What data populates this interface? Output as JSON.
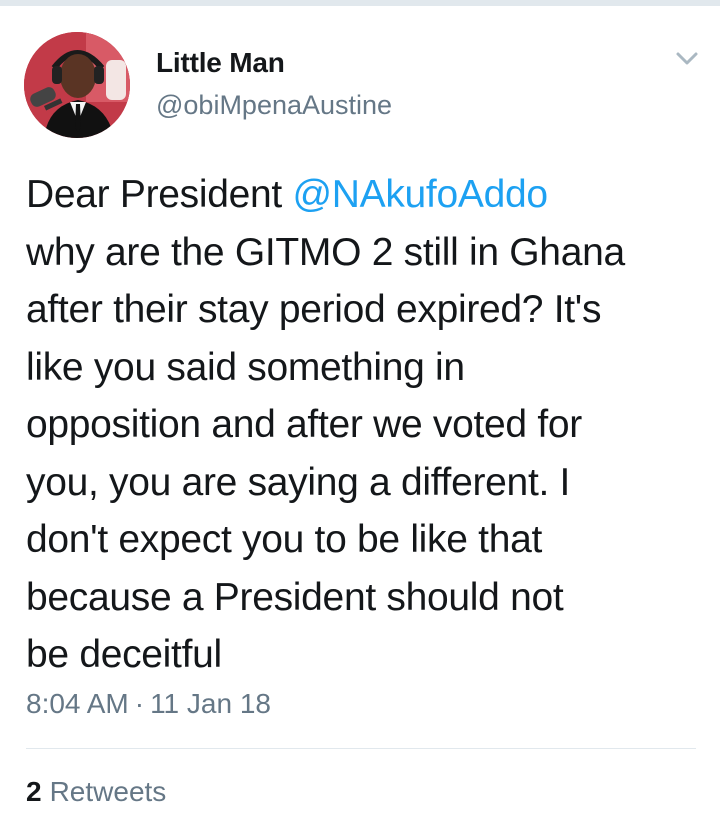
{
  "user": {
    "display_name": "Little Man",
    "handle": "@obiMpenaAustine"
  },
  "icons": {
    "menu": "chevron-down-icon",
    "avatar": "profile-photo"
  },
  "colors": {
    "link": "#1da1f2",
    "secondary_text": "#657786",
    "primary_text": "#14171a",
    "divider": "#e1e8ed"
  },
  "tweet": {
    "lines": [
      {
        "prefix": "Dear President ",
        "mention": "@NAkufoAddo"
      },
      {
        "text": "why are the GITMO 2 still in Ghana"
      },
      {
        "text": "after their stay period expired? It's"
      },
      {
        "text": "like you said something in"
      },
      {
        "text": "opposition and after we voted for"
      },
      {
        "text": "you, you are saying a different. I"
      },
      {
        "text": "don't expect you to be like that"
      },
      {
        "text": "because a President should not"
      },
      {
        "text": "be deceitful"
      }
    ]
  },
  "meta": {
    "time": "8:04 AM",
    "separator": "·",
    "date": "11 Jan 18"
  },
  "stats": {
    "retweets_count": "2",
    "retweets_label": "Retweets"
  }
}
